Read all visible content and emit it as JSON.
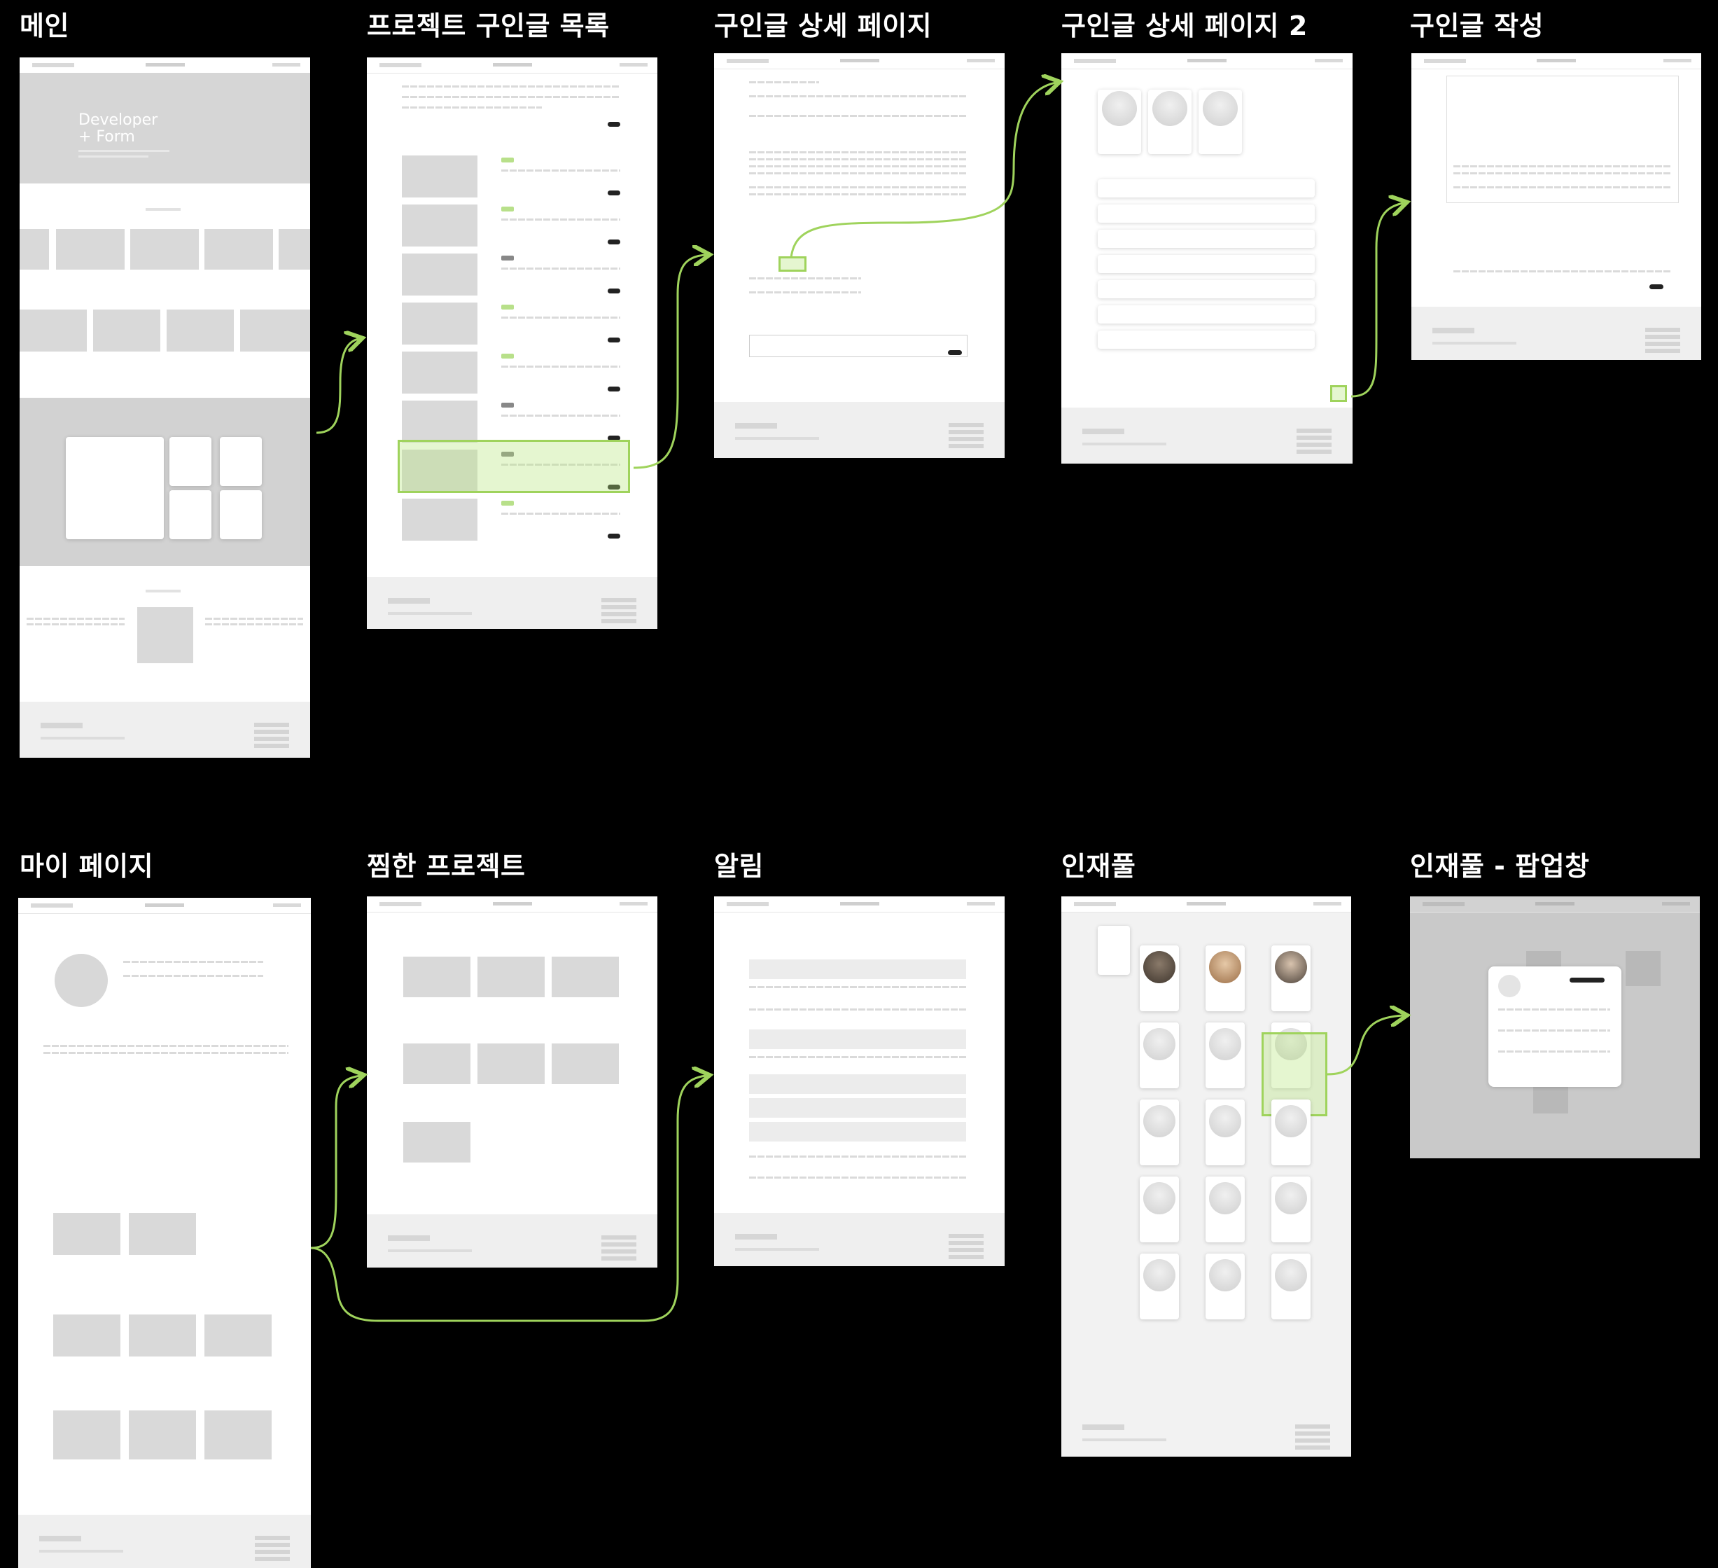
{
  "titles": [
    "메인",
    "프로젝트 구인글 목록",
    "구인글 상세 페이지",
    "구인글 상세 페이지 2",
    "구인글 작성",
    "마이 페이지",
    "찜한 프로젝트",
    "알림",
    "인재풀",
    "인재풀 - 팝업창"
  ],
  "main_frame": {
    "hero_line1": "Developer",
    "hero_line2": "+ Form"
  },
  "colors": {
    "background": "#000000",
    "accent_green": "#9fd35c",
    "wireframe_gray": "#d9d9d9",
    "footer_gray": "#efefef"
  },
  "arrows": [
    {
      "from": "메인",
      "to": "프로젝트 구인글 목록"
    },
    {
      "from": "프로젝트 구인글 목록",
      "to": "구인글 상세 페이지"
    },
    {
      "from": "구인글 상세 페이지",
      "to": "구인글 상세 페이지 2"
    },
    {
      "from": "구인글 상세 페이지 2",
      "to": "구인글 작성"
    },
    {
      "from": "마이 페이지",
      "to": "찜한 프로젝트"
    },
    {
      "from": "마이 페이지",
      "to": "알림"
    },
    {
      "from": "인재풀",
      "to": "인재풀 - 팝업창"
    }
  ]
}
